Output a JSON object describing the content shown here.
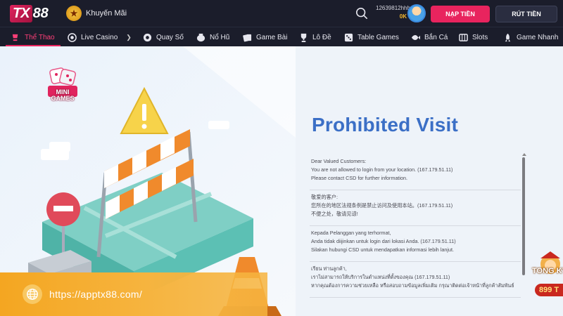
{
  "header": {
    "logo_text": "TX88",
    "promo_label": "Khuyến Mãi",
    "username": "12639812hhh",
    "balance": "0K",
    "deposit_label": "NẠP TIỀN",
    "withdraw_label": "RÚT TIỀN"
  },
  "nav": {
    "items": [
      {
        "label": "Thể Thao",
        "icon": "sports-icon"
      },
      {
        "label": "Live Casino",
        "icon": "casino-chip-icon"
      },
      {
        "label": "Quay Số",
        "icon": "lottery-ball-icon"
      },
      {
        "label": "Nổ Hũ",
        "icon": "jackpot-icon"
      },
      {
        "label": "Game Bài",
        "icon": "cards-icon"
      },
      {
        "label": "Lô Đề",
        "icon": "trophy-icon"
      },
      {
        "label": "Table Games",
        "icon": "dice-icon"
      },
      {
        "label": "Bắn Cá",
        "icon": "fish-icon"
      },
      {
        "label": "Slots",
        "icon": "slots-icon"
      },
      {
        "label": "Game Nhanh",
        "icon": "rocket-icon"
      }
    ]
  },
  "side": {
    "minigames_label": "MINI GAMES"
  },
  "main": {
    "title": "Prohibited Visit",
    "messages": [
      [
        "Dear Valued Customers:",
        "You are not allowed to login from your location. (167.179.51.11)",
        "Please contact CSD for further information."
      ],
      [
        "敬爱的客户:",
        "您所在的地区法规条例是禁止访问及使用本站。(167.179.51.11)",
        "不便之处，敬请见谅!"
      ],
      [
        "Kepada Pelanggan yang terhormat,",
        "Anda tidak diijinkan untuk login dari lokasi Anda. (167.179.51.11)",
        "Silakan hubungi CSD untuk mendapatkan informasi lebih lanjut."
      ],
      [
        "เรียน ท่านลูกค้า,",
        "เราไม่สามารถให้บริการในตำแหน่งที่ตั้งของคุณ (167.179.51.11)",
        "หากคุณต้องการความช่วยเหลือ หรือสอบถามข้อมูลเพิ่มเติม กรุณาติดต่อเจ้าหน้าที่ลูกค้าสัมพันธ์"
      ]
    ]
  },
  "overlay": {
    "url": "https://apptx88.com/"
  },
  "promo_badge": {
    "line1": "TONG KY",
    "line2": "899 T"
  },
  "colors": {
    "accent": "#e8245e",
    "title": "#3b6fc6",
    "header_bg": "#1b1d2b",
    "url_bar": "#f4a621"
  }
}
